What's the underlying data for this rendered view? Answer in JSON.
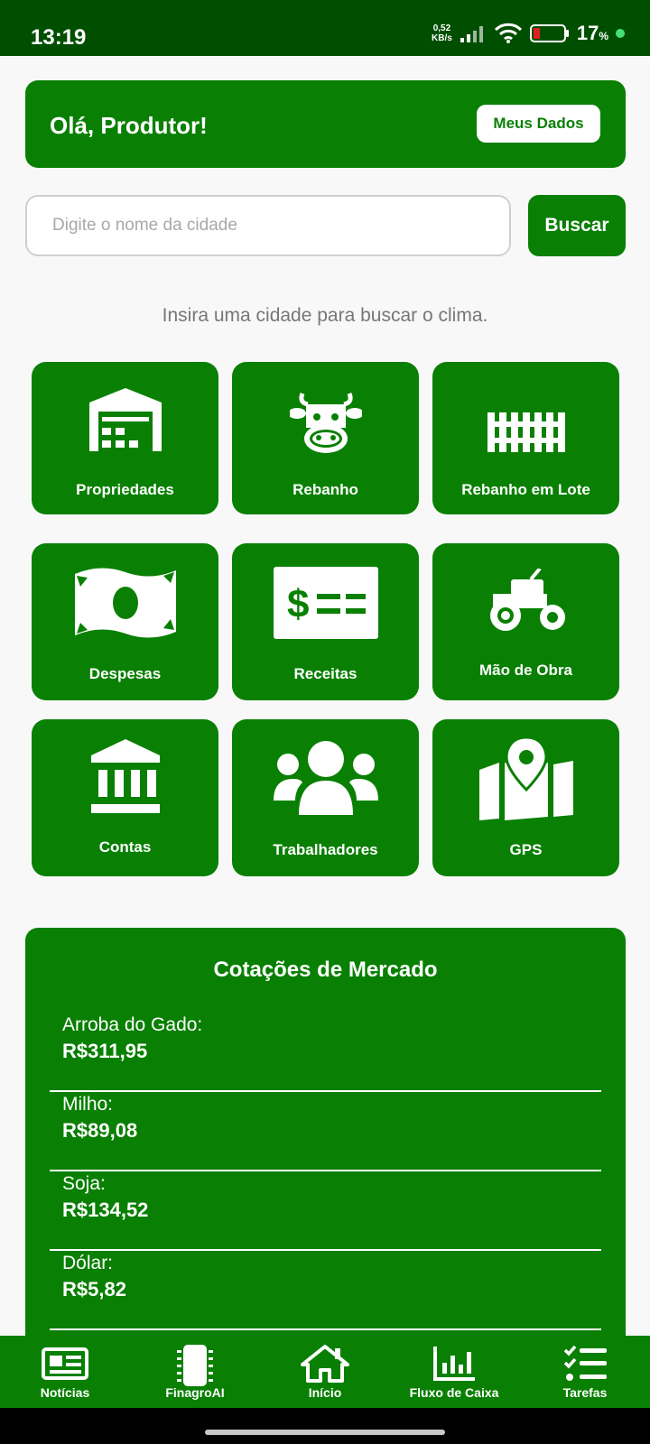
{
  "status_bar": {
    "time": "13:19",
    "net_speed_value": "0,52",
    "net_speed_unit": "KB/s",
    "battery_percent": "17",
    "battery_percent_sign": "%"
  },
  "greeting": {
    "text": "Olá, Produtor!",
    "my_data_label": "Meus Dados"
  },
  "search": {
    "placeholder": "Digite o nome da cidade",
    "button_label": "Buscar",
    "hint": "Insira uma cidade para buscar o clima."
  },
  "tiles": [
    {
      "label": "Propriedades",
      "icon": "warehouse-icon"
    },
    {
      "label": "Rebanho",
      "icon": "cow-icon"
    },
    {
      "label": "Rebanho em Lote",
      "icon": "fence-icon"
    },
    {
      "label": "Despesas",
      "icon": "money-bill-icon"
    },
    {
      "label": "Receitas",
      "icon": "money-check-icon"
    },
    {
      "label": "Mão de Obra",
      "icon": "tractor-icon"
    },
    {
      "label": "Contas",
      "icon": "bank-icon"
    },
    {
      "label": "Trabalhadores",
      "icon": "users-icon"
    },
    {
      "label": "GPS",
      "icon": "map-location-icon"
    }
  ],
  "market": {
    "title": "Cotações de Mercado",
    "quotes": [
      {
        "name": "Arroba do Gado:",
        "value": "R$311,95"
      },
      {
        "name": "Milho:",
        "value": "R$89,08"
      },
      {
        "name": "Soja:",
        "value": "R$134,52"
      },
      {
        "name": "Dólar:",
        "value": "R$5,82"
      }
    ]
  },
  "bottom_nav": [
    {
      "label": "Notícias",
      "icon": "newspaper-icon"
    },
    {
      "label": "FinagroAI",
      "icon": "chip-icon"
    },
    {
      "label": "Início",
      "icon": "home-icon"
    },
    {
      "label": "Fluxo de Caixa",
      "icon": "bar-chart-icon"
    },
    {
      "label": "Tarefas",
      "icon": "task-list-icon"
    }
  ],
  "colors": {
    "status_bar": "#004f00",
    "primary": "#098003",
    "background": "#f8f8f8",
    "hint_text": "#777777"
  }
}
